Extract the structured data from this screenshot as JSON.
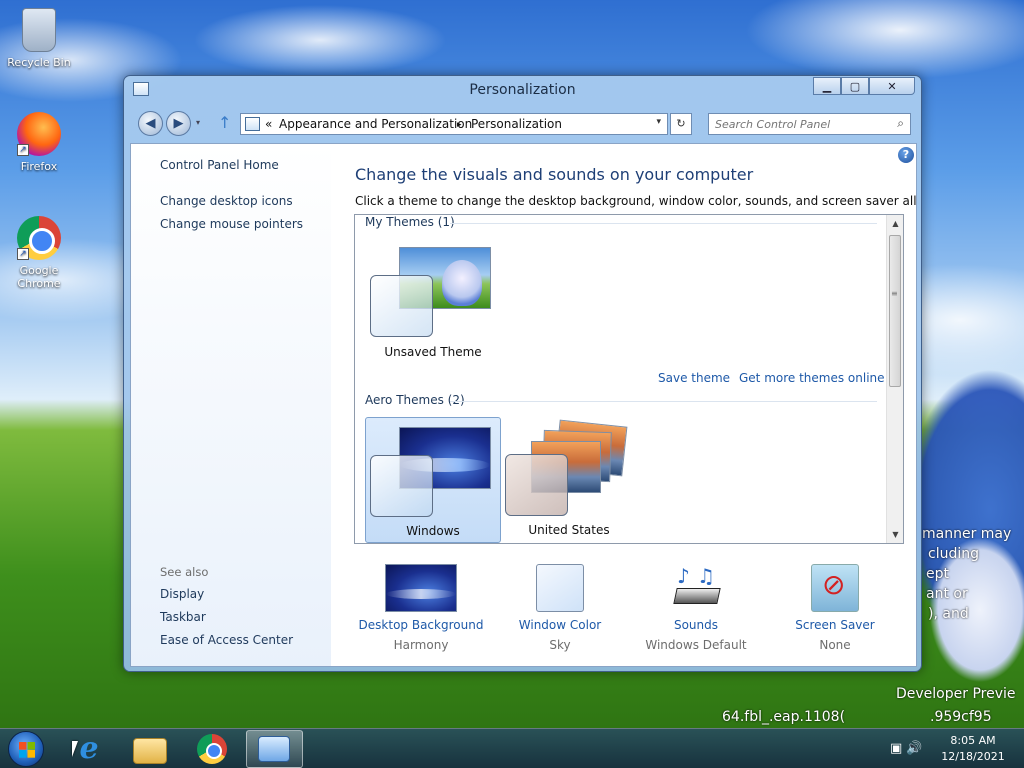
{
  "desktop": {
    "icons": [
      {
        "label": "Recycle Bin"
      },
      {
        "label": "Firefox"
      },
      {
        "label": "Google Chrome"
      }
    ],
    "watermark_lines": [
      "manner may",
      "cluding",
      "ept",
      "ant or",
      "), and",
      "Developer Previe",
      "64.fbl_.eap.1108(",
      ".959cf95"
    ]
  },
  "window": {
    "title": "Personalization",
    "caption": {
      "minimize": "▁",
      "maximize": "▢",
      "close": "✕"
    },
    "address": {
      "back": "◀",
      "forward": "▶",
      "up": "↑",
      "overflow": "«",
      "crumbs": [
        "Appearance and Personalization",
        "Personalization"
      ],
      "separator": "▸",
      "dropdown": "▾",
      "refresh": "↻",
      "search_placeholder": "Search Control Panel",
      "search_icon": "⌕"
    },
    "help_label": "?",
    "left_nav": {
      "home": "Control Panel Home",
      "links": [
        "Change desktop icons",
        "Change mouse pointers"
      ],
      "see_also_label": "See also",
      "see_also": [
        "Display",
        "Taskbar",
        "Ease of Access Center"
      ]
    },
    "main": {
      "heading": "Change the visuals and sounds on your computer",
      "subheading": "Click a theme to change the desktop background, window color, sounds, and screen saver all at once.",
      "groups": {
        "my_themes": {
          "label": "My Themes (1)",
          "themes": [
            {
              "name": "Unsaved Theme"
            }
          ]
        },
        "aero_themes": {
          "label": "Aero Themes (2)",
          "themes": [
            {
              "name": "Windows",
              "selected": true
            },
            {
              "name": "United States"
            }
          ]
        }
      },
      "save_theme": "Save theme",
      "get_more": "Get more themes online",
      "scroll_grip": "≡",
      "scroll_up": "▲",
      "scroll_down": "▼",
      "bottom": [
        {
          "label": "Desktop Background",
          "value": "Harmony"
        },
        {
          "label": "Window Color",
          "value": "Sky"
        },
        {
          "label": "Sounds",
          "value": "Windows Default"
        },
        {
          "label": "Screen Saver",
          "value": "None"
        }
      ]
    }
  },
  "taskbar": {
    "ie_glyph": "e",
    "tray_glyphs": "▣ 🔊",
    "time": "8:05 AM",
    "date": "12/18/2021"
  }
}
